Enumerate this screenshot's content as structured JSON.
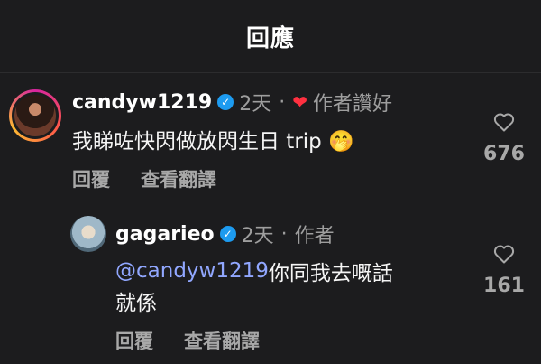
{
  "header": {
    "title": "回應"
  },
  "comments": [
    {
      "username": "candyw1219",
      "verified_glyph": "✓",
      "time": "2天",
      "separator": "·",
      "creator_liked_label": "作者讚好",
      "text": "我睇咗快閃做放閃生日 trip 🤭",
      "reply_label": "回覆",
      "translate_label": "查看翻譯",
      "likes": "676"
    },
    {
      "username": "gagarieo",
      "verified_glyph": "✓",
      "time": "2天",
      "separator": "·",
      "author_label": "作者",
      "mention": "@candyw1219",
      "text_line1": " 你同我去嘅話",
      "text_line2": "就係",
      "reply_label": "回覆",
      "translate_label": "查看翻譯",
      "likes": "161"
    }
  ],
  "colors": {
    "background": "#1c1c1e",
    "verified": "#1d9bf0",
    "heart": "#ff3040",
    "mention": "#91a7ff"
  },
  "icons": [
    "verified-badge-icon",
    "heart-icon",
    "like-outline-icon"
  ]
}
